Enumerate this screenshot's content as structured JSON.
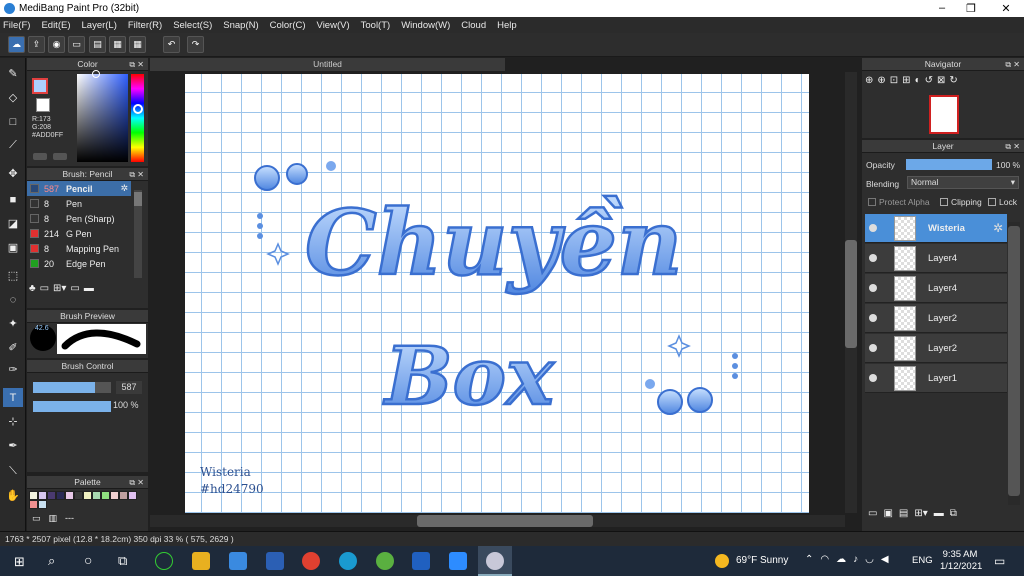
{
  "window": {
    "title": "MediBang Paint Pro (32bit)",
    "minimize": "–",
    "maximize": "❐",
    "close": "✕"
  },
  "menu": [
    "File(F)",
    "Edit(E)",
    "Layer(L)",
    "Filter(R)",
    "Select(S)",
    "Snap(N)",
    "Color(C)",
    "View(V)",
    "Tool(T)",
    "Window(W)",
    "Cloud",
    "Help"
  ],
  "doc_tab": "Untitled",
  "color_panel": {
    "title": "Color",
    "r": "R:173",
    "g": "G:208",
    "hex": "#ADD0FF",
    "primary_color": "#ADD0FF"
  },
  "brush_panel": {
    "title": "Brush: Pencil",
    "items": [
      {
        "size": "587",
        "name": "Pencil",
        "color": "#2a4a7a",
        "selected": true
      },
      {
        "size": "8",
        "name": "Pen",
        "color": "#333333"
      },
      {
        "size": "8",
        "name": "Pen (Sharp)",
        "color": "#333333"
      },
      {
        "size": "214",
        "name": "G Pen",
        "color": "#e03030"
      },
      {
        "size": "8",
        "name": "Mapping Pen",
        "color": "#e03030"
      },
      {
        "size": "20",
        "name": "Edge Pen",
        "color": "#20a020"
      }
    ]
  },
  "brush_preview": {
    "title": "Brush Preview",
    "size": "42.6"
  },
  "brush_control": {
    "title": "Brush Control",
    "size": "587",
    "opacity": "100 %",
    "size_fraction": 0.8,
    "opacity_fraction": 1.0
  },
  "palette": {
    "title": "Palette",
    "colors": [
      "#f3f3e0",
      "#d8c8f0",
      "#4a3a70",
      "#2a2a55",
      "#e8c8e8",
      "#3a3a3a",
      "#f0f0c0",
      "#a8d8b0",
      "#90e080",
      "#f0d0d0",
      "#c0a0a0",
      "#e0c0f0",
      "#f09090",
      "#c8e0f0"
    ],
    "more": "---"
  },
  "canvas": {
    "line1": "Chuyền",
    "line2": "Box",
    "signature1": "Wisteria",
    "signature2": "#hd24790"
  },
  "navigator": {
    "title": "Navigator"
  },
  "layer_panel": {
    "title": "Layer",
    "opacity_label": "Opacity",
    "opacity_value": "100 %",
    "blending_label": "Blending",
    "blending_value": "Normal",
    "protect_alpha": "Protect Alpha",
    "clipping": "Clipping",
    "lock": "Lock",
    "layers": [
      {
        "name": "Wisteria",
        "selected": true
      },
      {
        "name": "Layer4"
      },
      {
        "name": "Layer4"
      },
      {
        "name": "Layer2"
      },
      {
        "name": "Layer2"
      },
      {
        "name": "Layer1"
      }
    ]
  },
  "status": "1763 * 2507 pixel  (12.8 * 18.2cm)  350 dpi  33 %  ( 575, 2629 )",
  "taskbar": {
    "weather_temp": "69°F",
    "weather_text": "Sunny",
    "lang": "ENG",
    "time": "9:35 AM",
    "date": "1/12/2021"
  }
}
